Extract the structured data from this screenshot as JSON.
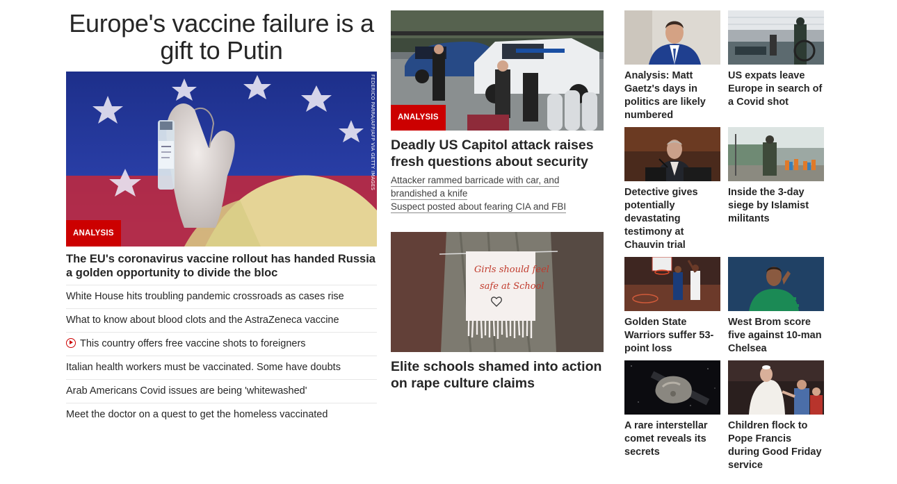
{
  "main_story": {
    "headline": "Europe's vaccine failure is a gift to Putin",
    "badge": "ANALYSIS",
    "photo_credit": "FEDERICO PARRA/AFP/AFP VIA GETTY IMAGES",
    "lede": "The EU's coronavirus vaccine rollout has handed Russia a golden opportunity to divide the bloc",
    "related": [
      {
        "text": "White House hits troubling pandemic crossroads as cases rise",
        "video": false
      },
      {
        "text": "What to know about blood clots and the AstraZeneca vaccine",
        "video": false
      },
      {
        "text": "This country offers free vaccine shots to foreigners",
        "video": true
      },
      {
        "text": "Italian health workers must be vaccinated. Some have doubts",
        "video": false
      },
      {
        "text": "Arab Americans Covid issues are being 'whitewashed'",
        "video": false
      },
      {
        "text": "Meet the doctor on a quest to get the homeless vaccinated",
        "video": false
      }
    ]
  },
  "center_stories": [
    {
      "badge": "ANALYSIS",
      "title": "Deadly US Capitol attack raises fresh questions about security",
      "links": [
        "Attacker rammed barricade with car, and brandished a knife",
        "Suspect posted about fearing CIA and FBI"
      ]
    },
    {
      "title": "Elite schools shamed into action on rape culture claims",
      "sign_text": "Girls should feel safe at School"
    }
  ],
  "grid_stories": [
    {
      "title": "Analysis: Matt Gaetz's days in politics are likely numbered"
    },
    {
      "title": "US expats leave Europe in search of a Covid shot"
    },
    {
      "title": "Detective gives potentially devastating testimony at Chauvin trial"
    },
    {
      "title": "Inside the 3-day siege by Islamist militants"
    },
    {
      "title": "Golden State Warriors suffer 53-point loss"
    },
    {
      "title": "West Brom score five against 10-man Chelsea"
    },
    {
      "title": "A rare interstellar comet reveals its secrets"
    },
    {
      "title": "Children flock to Pope Francis during Good Friday service"
    }
  ],
  "colors": {
    "accent": "#cc0000",
    "text": "#262626",
    "divider": "#e6e6e6"
  }
}
